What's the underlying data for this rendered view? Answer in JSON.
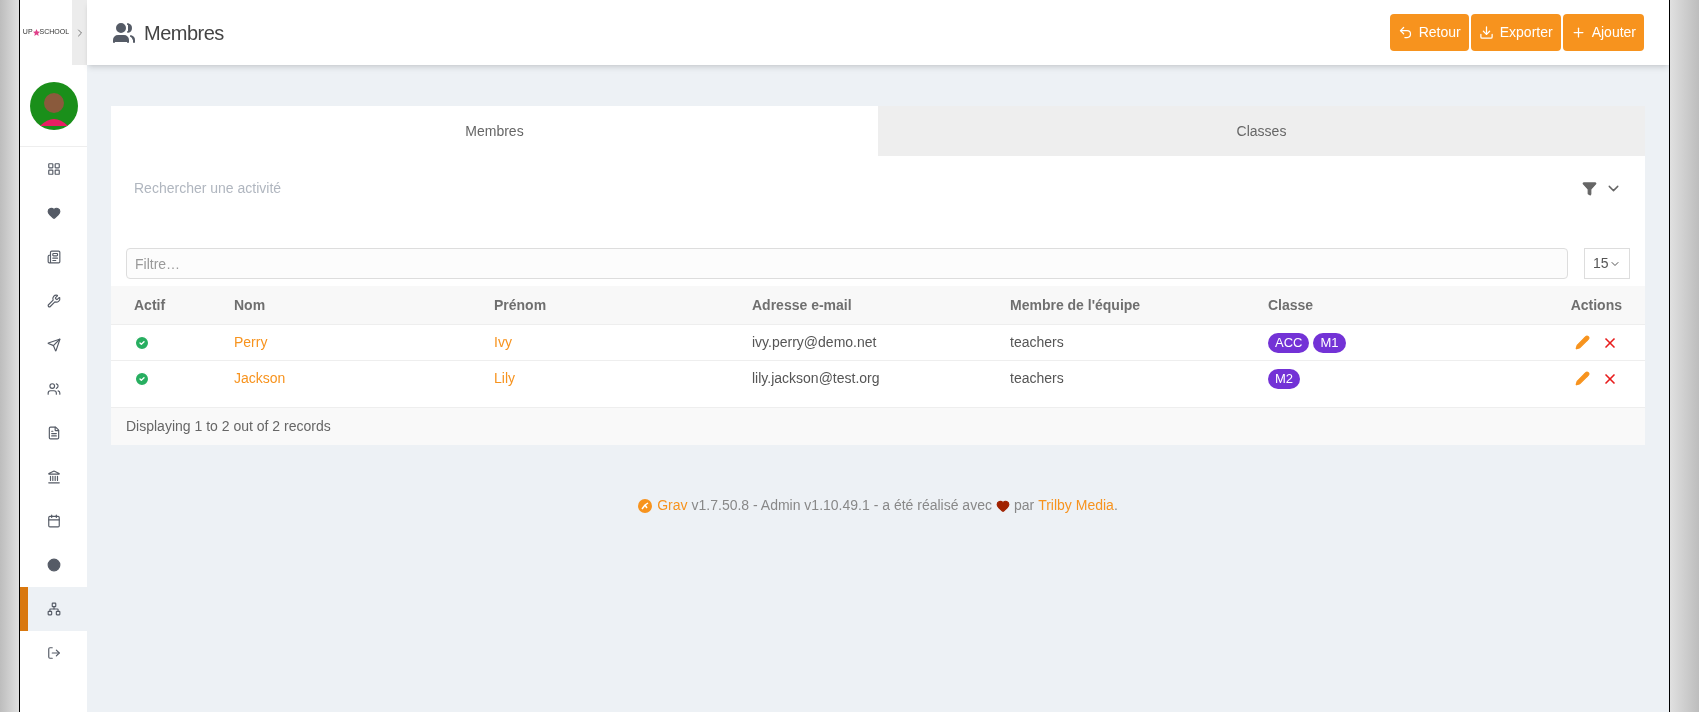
{
  "logo": {
    "left": "UP",
    "right": "SCHOOL"
  },
  "nav": [
    {
      "selected": false
    },
    {
      "selected": false
    },
    {
      "selected": false
    },
    {
      "selected": false
    },
    {
      "selected": false
    },
    {
      "selected": false
    },
    {
      "selected": false
    },
    {
      "selected": false
    },
    {
      "selected": false
    },
    {
      "selected": false
    },
    {
      "selected": true
    },
    {
      "selected": false
    }
  ],
  "page_title": "Membres",
  "header_buttons": [
    "Retour",
    "Exporter",
    "Ajouter"
  ],
  "tabs": [
    {
      "label": "Membres",
      "selected": true
    },
    {
      "label": "Classes",
      "selected": false
    }
  ],
  "search": {
    "placeholder": "Rechercher une activité"
  },
  "filter": {
    "placeholder": "Filtre…"
  },
  "page_size": "15",
  "table": {
    "columns": [
      "Actif",
      "Nom",
      "Prénom",
      "Adresse e-mail",
      "Membre de l'équipe",
      "Classe",
      "Actions"
    ],
    "rows": [
      {
        "active": true,
        "nom": "Perry",
        "prenom": "Ivy",
        "email": "ivy.perry@demo.net",
        "team": "teachers",
        "classes": [
          "ACC",
          "M1"
        ]
      },
      {
        "active": true,
        "nom": "Jackson",
        "prenom": "Lily",
        "email": "lily.jackson@test.org",
        "team": "teachers",
        "classes": [
          "M2"
        ]
      }
    ]
  },
  "records": "Displaying 1 to 2 out of 2 records",
  "footer": {
    "grav": "Grav",
    "middle": "v1.7.50.8 - Admin v1.10.49.1 - a été réalisé avec",
    "par": "par",
    "trilby": "Trilby Media",
    "end": "."
  }
}
